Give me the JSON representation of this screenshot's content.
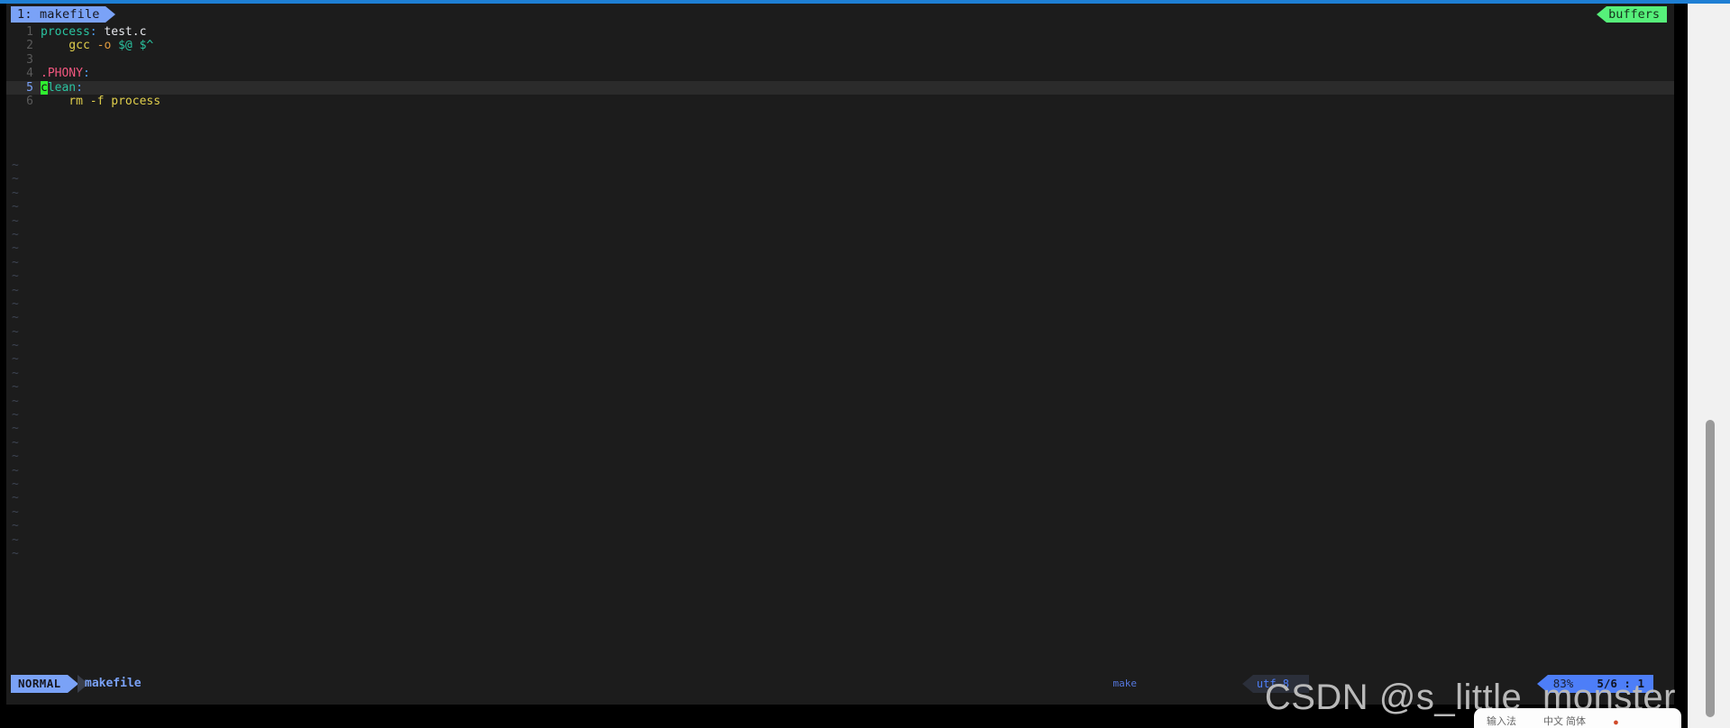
{
  "window": {
    "app": "neovim",
    "background": "#1c1c1c",
    "accent_blue": "#7aa2f7",
    "accent_green": "#56f07a"
  },
  "bufferline": {
    "tabs": [
      {
        "label": "1: makefile",
        "active": true
      }
    ],
    "right_label": "buffers"
  },
  "editor": {
    "filetype": "make",
    "lines": [
      {
        "number": "1",
        "current": false,
        "tokens": [
          {
            "text": "process",
            "kind": "target"
          },
          {
            "text": ":",
            "kind": "colon"
          },
          {
            "text": " test.c",
            "kind": "dep"
          }
        ]
      },
      {
        "number": "2",
        "current": false,
        "tokens": [
          {
            "text": "    gcc",
            "kind": "cmd"
          },
          {
            "text": " -o",
            "kind": "flag"
          },
          {
            "text": " $@ $^",
            "kind": "var"
          }
        ]
      },
      {
        "number": "3",
        "current": false,
        "tokens": []
      },
      {
        "number": "4",
        "current": false,
        "tokens": [
          {
            "text": ".PHONY",
            "kind": "phony"
          },
          {
            "text": ":",
            "kind": "colon"
          }
        ]
      },
      {
        "number": "5",
        "current": true,
        "tokens": [
          {
            "text": "c",
            "kind": "cursor"
          },
          {
            "text": "lean",
            "kind": "target"
          },
          {
            "text": ":",
            "kind": "colon"
          }
        ]
      },
      {
        "number": "6",
        "current": false,
        "tokens": [
          {
            "text": "    rm -f process",
            "kind": "plain"
          }
        ]
      }
    ],
    "filler_char": "~",
    "filler_count": 29
  },
  "statusline": {
    "mode": "NORMAL",
    "filename": "makefile",
    "filetype": "make",
    "encoding": "utf-8",
    "percent": "83%",
    "position": "5/6 :   1"
  },
  "watermark": {
    "text": "CSDN @s_little_monster"
  },
  "bottom_popup": {
    "left_text": "输入法",
    "right_text": "中文  简体"
  }
}
